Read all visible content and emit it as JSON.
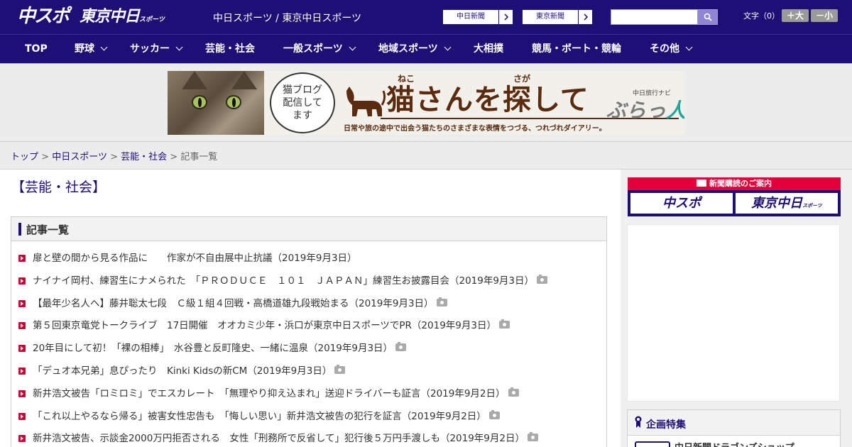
{
  "header": {
    "logo_chuspo": "中スポ",
    "logo_tokyo": "東京中日",
    "logo_tokyo_small": "スポーツ",
    "site_names": "中日スポーツ / 東京中日スポーツ",
    "btn_chunichi": "中日新聞",
    "btn_tokyo": "東京新聞",
    "search_placeholder": "",
    "font_size_label": "文字（0）",
    "font_bigger": "＋大",
    "font_smaller": "－小"
  },
  "nav": {
    "items": [
      {
        "label": "TOP"
      },
      {
        "label": "野球"
      },
      {
        "label": "サッカー"
      },
      {
        "label": "芸能・社会"
      },
      {
        "label": "一般スポーツ"
      },
      {
        "label": "地域スポーツ"
      },
      {
        "label": "大相撲"
      },
      {
        "label": "競馬・ボート・競輪"
      },
      {
        "label": "その他"
      }
    ]
  },
  "banner": {
    "bubble_text": "猫ブログ配信してます",
    "title": "猫さんを探して",
    "ruby_neko": "ねこ",
    "ruby_saga": "さが",
    "subtitle": "日常や旅の途中で出会う猫たちのさまざまな表情をつづる、つれづれダイアリー。",
    "brand_small": "中日旅行ナビ",
    "brand_main": "ぶらっ",
    "brand_accent": "人"
  },
  "breadcrumb": {
    "items": [
      "トップ",
      "中日スポーツ",
      "芸能・社会"
    ],
    "separator": ">",
    "current": "記事一覧"
  },
  "page": {
    "title": "【芸能・社会】",
    "list_heading": "記事一覧"
  },
  "articles": [
    {
      "text": "扉と壁の間から見る作品に　　作家が不自由展中止抗議（2019年9月3日）",
      "photo": false
    },
    {
      "text": "ナイナイ岡村、練習生にナメられた　「ＰＲＯＤＵＣＥ　１０１　ＪＡＰＡＮ」練習生お披露目会（2019年9月3日）",
      "photo": true
    },
    {
      "text": "【最年少名人へ】藤井聡太七段　Ｃ級１組４回戦・高橋道雄九段戦始まる（2019年9月3日）",
      "photo": true
    },
    {
      "text": "第５回東京竜党トークライブ　17日開催　オオカミ少年・浜口が東京中日スポーツでPR（2019年9月3日）",
      "photo": true
    },
    {
      "text": "20年目にして初！「裸の相棒」　水谷豊と反町隆史、一緒に温泉（2019年9月3日）",
      "photo": true
    },
    {
      "text": "「デュオ本兄弟」息ぴったり　Kinki Kidsの新CM（2019年9月3日）",
      "photo": true
    },
    {
      "text": "新井浩文被告「ロミロミ」でエスカレート　「無理やり抑え込まれ」送迎ドライバーも証言（2019年9月2日）",
      "photo": true
    },
    {
      "text": "「これ以上やるなら帰る」被害女性忠告も　「悔しい思い」新井浩文被告の犯行を証言（2019年9月2日）",
      "photo": true
    },
    {
      "text": "新井浩文被告、示談金2000万円拒否される　女性「刑務所で反省して」犯行後５万円手渡しも（2019年9月2日）",
      "photo": true
    }
  ],
  "sidebar": {
    "subscribe_heading": "新聞購読のご案内",
    "sub_logo_chuspo": "中スポ",
    "sub_logo_tokyo": "東京中日",
    "sub_logo_tokyo_small": "スポーツ",
    "feature_heading": "企画特集",
    "feature_item": "中日新聞ドラゴンズショップ"
  },
  "colors": {
    "brand_navy": "#1e0f77",
    "accent_red": "#cc0033",
    "subscribe_red": "#e4003a"
  }
}
